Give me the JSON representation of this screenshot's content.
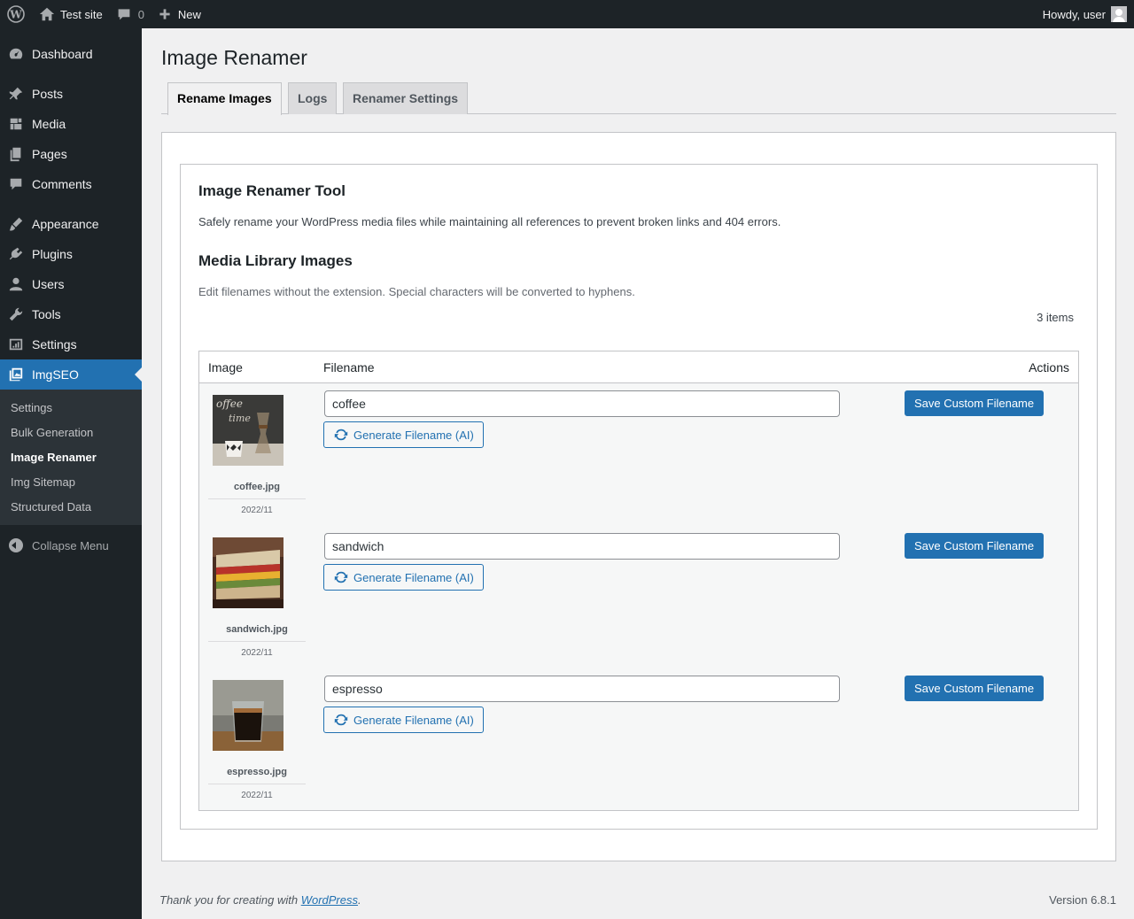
{
  "adminbar": {
    "site_name": "Test site",
    "comments_count": "0",
    "new_label": "New",
    "howdy": "Howdy, user"
  },
  "sidebar": {
    "items": [
      {
        "label": "Dashboard",
        "icon": "dashboard-icon"
      },
      {
        "label": "Posts",
        "icon": "pin-icon"
      },
      {
        "label": "Media",
        "icon": "media-icon"
      },
      {
        "label": "Pages",
        "icon": "pages-icon"
      },
      {
        "label": "Comments",
        "icon": "comment-icon"
      },
      {
        "label": "Appearance",
        "icon": "brush-icon"
      },
      {
        "label": "Plugins",
        "icon": "plugin-icon"
      },
      {
        "label": "Users",
        "icon": "user-icon"
      },
      {
        "label": "Tools",
        "icon": "wrench-icon"
      },
      {
        "label": "Settings",
        "icon": "settings-icon"
      },
      {
        "label": "ImgSEO",
        "icon": "images-icon"
      }
    ],
    "submenu": [
      "Settings",
      "Bulk Generation",
      "Image Renamer",
      "Img Sitemap",
      "Structured Data"
    ],
    "collapse_label": "Collapse Menu"
  },
  "page": {
    "title": "Image Renamer",
    "tabs": [
      "Rename Images",
      "Logs",
      "Renamer Settings"
    ],
    "tool_title": "Image Renamer Tool",
    "tool_desc": "Safely rename your WordPress media files while maintaining all references to prevent broken links and 404 errors.",
    "lib_title": "Media Library Images",
    "lib_desc": "Edit filenames without the extension. Special characters will be converted to hyphens.",
    "items_count": "3 items"
  },
  "table": {
    "headers": [
      "Image",
      "Filename",
      "Actions"
    ],
    "generate_label": "Generate Filename (AI)",
    "save_label": "Save Custom Filename",
    "rows": [
      {
        "file": "coffee.jpg",
        "date": "2022/11",
        "value": "coffee"
      },
      {
        "file": "sandwich.jpg",
        "date": "2022/11",
        "value": "sandwich"
      },
      {
        "file": "espresso.jpg",
        "date": "2022/11",
        "value": "espresso"
      }
    ]
  },
  "footer": {
    "thanks_prefix": "Thank you for creating with ",
    "wp_link": "WordPress",
    "thanks_suffix": ".",
    "version": "Version 6.8.1"
  },
  "colors": {
    "adminbar_bg": "#1d2327",
    "accent": "#2271b1",
    "page_bg": "#f0f0f1"
  }
}
